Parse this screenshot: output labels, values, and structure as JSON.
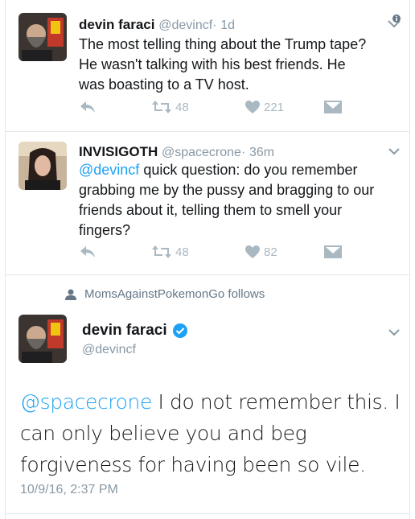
{
  "tweets": [
    {
      "name": "devin faraci",
      "handle": "@devincf",
      "dot": "·",
      "time": "1d",
      "text": "The most telling thing about the Trump tape? He wasn't talking with his best friends. He was boasting to a TV host.",
      "retweets": "48",
      "likes": "221"
    },
    {
      "name": "INVISIGOTH",
      "handle": "@spacecrone",
      "dot": "·",
      "time": "36m",
      "mention": "@devincf",
      "text": " quick question: do you remember grabbing me by the pussy and bragging to our friends about it, telling them to smell your fingers?",
      "retweets": "48",
      "likes": "82"
    }
  ],
  "follows_text": "MomsAgainstPokemonGo follows",
  "main_tweet": {
    "name": "devin faraci",
    "handle": "@devincf",
    "mention": "@spacecrone",
    "text": " I do not remember this. I can only believe you and beg forgiveness for having been so vile.",
    "timestamp": "10/9/16, 2:37 PM"
  },
  "colors": {
    "link": "#1da1f2",
    "muted": "#8899a6",
    "icon": "#aab8c2",
    "verified": "#1da1f2"
  },
  "icons": [
    "reply-icon",
    "retweet-icon",
    "heart-icon",
    "dm-icon",
    "chevron-down-icon",
    "person-icon",
    "verified-icon",
    "info-icon"
  ]
}
